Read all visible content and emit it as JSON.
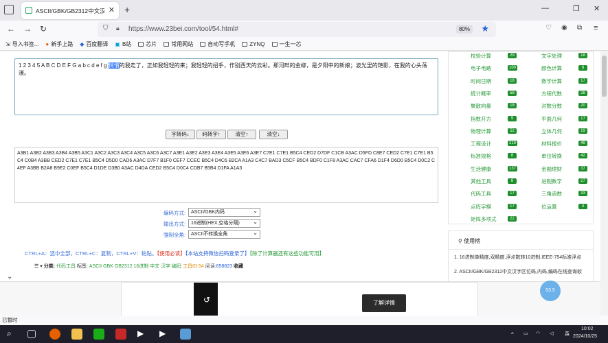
{
  "browser": {
    "tab_title": "ASCII/GBK/GB2312中文汉字区",
    "tab_close": "✕",
    "new_tab": "+",
    "url": "https://www.23bei.com/tool/54.html#",
    "zoom": "80%",
    "win_min": "—",
    "win_max": "❐",
    "win_close": "✕"
  },
  "bookmarks": [
    "导入书签...",
    "新手上路",
    "百度翻译",
    "B站",
    "芯片",
    "常用网站",
    "自动写手机",
    "ZYNQ",
    "一生一芯"
  ],
  "editor": {
    "input_before": "1 2 3 4 5 A B C D E F G a b c d e f g ",
    "input_selected": "悄悄",
    "input_after": "的我走了，正如我轻轻的来；我轻轻的招手，作别西天的云彩。那河畔的金柳，是夕阳中的新娘；波光里的艳影，在我的心头荡漾。",
    "btn_char_to_code": "字转码↓",
    "btn_code_to_char": "码转字↑",
    "btn_clear1": "清空↑",
    "btn_clear2": "清空↓",
    "output": "A3B1 A3B2 A3B3 A3B4 A3B5 A3C1 A3C2 A3C3 A3C4 A3C5 A3C6 A3C7 A3E1 A3E2 A3E3 A3E4 A3E5 A3E6 A3E7 C7E1 C7E1 B5C4 CED2 D7DF C1CB A3AC D5FD C8E7 CED2 C7E1 C7E1 B5C4 C0B4 A3BB CED2 C7E1 C7E1 B5C4 D5D0 CAD6 A3AC D7F7 B1F0 CEF7 CCEC B5C4 D4C6 B2CA A1A3 C4C7 BAD3 C5CF B5C4 BDF0 C1F8 A3AC CAC7 CFA6 D1F4 D6D0 B5C4 D0C2 C4EF A3BB B2A8 B9E2 C0EF B5C4 D1DE D3B0 A3AC D4DA CED2 B5C4 D0C4 CDB7 B5B4 D1FA A1A3"
  },
  "options": {
    "encoding_label": "编码方式:",
    "encoding_value": "ASCII/GBK内码",
    "output_label": "输出方式:",
    "output_value": "16进制(HEX,空格分隔)",
    "fullwidth_label": "强制全角:",
    "fullwidth_value": "ASCII不转换全角"
  },
  "hint": {
    "shortcuts": "CTRL+A：选中全部，CTRL+C：复制，CTRL+V：粘贴。",
    "must_read": "【使用必读】",
    "wechat": "【本站支持微信扫码登录了】",
    "more": "【除了计算器还有这些功能可用】"
  },
  "meta": {
    "menu": "☰ ▾",
    "category_label": "分类:",
    "category": "代码工具",
    "tags_label": "标签:",
    "tags": "ASCII GBK GB2312 16进制 中文 汉字 编码",
    "tool_id_label": "工具ID:",
    "tool_id": "54",
    "views_label": "阅读:",
    "views": "658823",
    "fav": "收藏"
  },
  "categories_left": [
    {
      "name": "校验计算",
      "count": "29"
    },
    {
      "name": "电子电路",
      "count": "100"
    },
    {
      "name": "时间日期",
      "count": "18"
    },
    {
      "name": "统计概率",
      "count": "58"
    },
    {
      "name": "聚散向量",
      "count": "18"
    },
    {
      "name": "指数开方",
      "count": "9"
    },
    {
      "name": "物理计算",
      "count": "52"
    },
    {
      "name": "工程设计",
      "count": "219"
    },
    {
      "name": "标准规格",
      "count": "8"
    },
    {
      "name": "生活健康",
      "count": "137"
    },
    {
      "name": "其他工具",
      "count": "8"
    },
    {
      "name": "代码工具",
      "count": "17"
    },
    {
      "name": "点阵字模",
      "count": "17"
    },
    {
      "name": "矩阵多项式",
      "count": "22"
    }
  ],
  "categories_right": [
    {
      "name": "文字处理",
      "count": "18"
    },
    {
      "name": "颜色计算",
      "count": "6"
    },
    {
      "name": "数学计算",
      "count": "17"
    },
    {
      "name": "方程代数",
      "count": "28"
    },
    {
      "name": "对数分数",
      "count": "20"
    },
    {
      "name": "平面几何",
      "count": "17"
    },
    {
      "name": "立体几何",
      "count": "19"
    },
    {
      "name": "材料报价",
      "count": "49"
    },
    {
      "name": "单位转换",
      "count": "42"
    },
    {
      "name": "金融理财",
      "count": "37"
    },
    {
      "name": "进制数字",
      "count": "27"
    },
    {
      "name": "三角函数",
      "count": "33"
    },
    {
      "name": "位运算",
      "count": "4"
    }
  ],
  "ranking": {
    "title": "使用榜",
    "items": [
      "1. 16进制单精度,双精度,浮点数转10进制,IEEE-754标准浮点",
      "2. ASCII/GBK/GB2312中文汉字区位码,内码,编码在线查询软"
    ]
  },
  "ad": {
    "cta": "了解详情",
    "replay": "↺",
    "float": "53.5"
  },
  "status": "已暂时",
  "taskbar": {
    "ime": "英",
    "time": "10:02",
    "date": "2024/10/25"
  }
}
